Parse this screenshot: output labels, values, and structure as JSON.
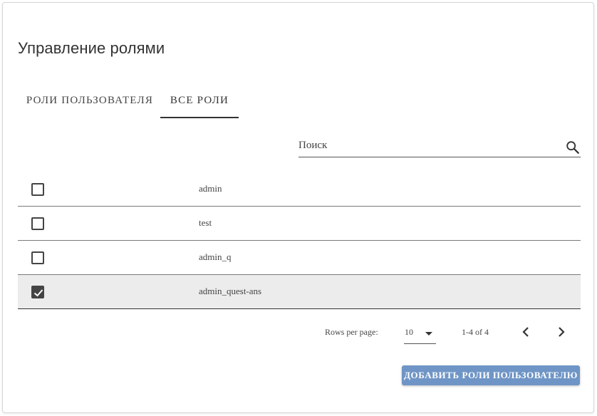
{
  "title": "Управление ролями",
  "tabs": [
    {
      "label": "РОЛИ ПОЛЬЗОВАТЕЛЯ",
      "active": false
    },
    {
      "label": "ВСЕ РОЛИ",
      "active": true
    }
  ],
  "search": {
    "placeholder": "Поиск",
    "value": "",
    "icon": "search-icon"
  },
  "roles": [
    {
      "name": "admin",
      "checked": false
    },
    {
      "name": "test",
      "checked": false
    },
    {
      "name": "admin_q",
      "checked": false
    },
    {
      "name": "admin_quest-ans",
      "checked": true
    }
  ],
  "pagination": {
    "rows_per_page_label": "Rows per page:",
    "rows_per_page": "10",
    "range": "1-4 of 4",
    "prev_icon": "chevron-left-icon",
    "next_icon": "chevron-right-icon"
  },
  "add_button_label": "ДОБАВИТЬ РОЛИ ПОЛЬЗОВАТЕЛЮ",
  "colors": {
    "primary_button": "#6f95c6",
    "selected_row": "#ececec",
    "text": "#444444"
  }
}
